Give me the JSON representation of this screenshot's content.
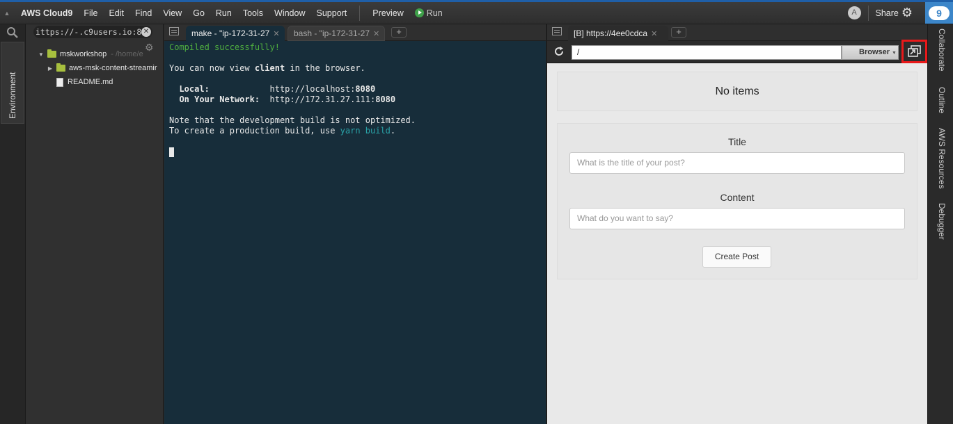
{
  "menubar": {
    "brand": "AWS Cloud9",
    "items": [
      "File",
      "Edit",
      "Find",
      "View",
      "Go",
      "Run",
      "Tools",
      "Window",
      "Support"
    ],
    "preview_label": "Preview",
    "run_label": "Run",
    "avatar_initial": "A",
    "share_label": "Share",
    "logo_text": "9"
  },
  "left_rail": {
    "environment_tab": "Environment"
  },
  "tree": {
    "url_value": "ittps://-.c9users.io:8",
    "rows": [
      {
        "label": "mskworkshop",
        "sub": "- /home/e",
        "kind": "folder",
        "expanded": true
      },
      {
        "label": "aws-msk-content-streamir",
        "kind": "folder",
        "expanded": false
      },
      {
        "label": "README.md",
        "kind": "file"
      }
    ]
  },
  "terminal": {
    "tabs": [
      {
        "label": "make - \"ip-172-31-27",
        "active": true
      },
      {
        "label": "bash - \"ip-172-31-27",
        "active": false
      }
    ],
    "lines": {
      "compiled": "Compiled successfully!",
      "view_prefix": "You can now view ",
      "view_client": "client",
      "view_suffix": " in the browser.",
      "local_label": "  Local:            ",
      "local_url": "http://localhost:",
      "local_port": "8080",
      "network_label": "  On Your Network:  ",
      "network_url": "http://172.31.27.111:",
      "network_port": "8080",
      "note1": "Note that the development build is not optimized.",
      "note2_prefix": "To create a production build, use ",
      "note2_cmd": "yarn build",
      "note2_suffix": "."
    }
  },
  "browser": {
    "tab_label": "[B] https://4ee0cdca",
    "address_value": "/",
    "browser_select": "Browser",
    "empty_text": "No items",
    "form": {
      "title_label": "Title",
      "title_placeholder": "What is the title of your post?",
      "content_label": "Content",
      "content_placeholder": "What do you want to say?",
      "submit_label": "Create Post"
    }
  },
  "right_rail": {
    "tabs": [
      "Collaborate",
      "Outline",
      "AWS Resources",
      "Debugger"
    ]
  },
  "colors": {
    "accent_blue": "#1f5fa8",
    "terminal_bg": "#172d3a",
    "highlight_red": "#e8191a",
    "folder_green": "#a7bf3e"
  }
}
